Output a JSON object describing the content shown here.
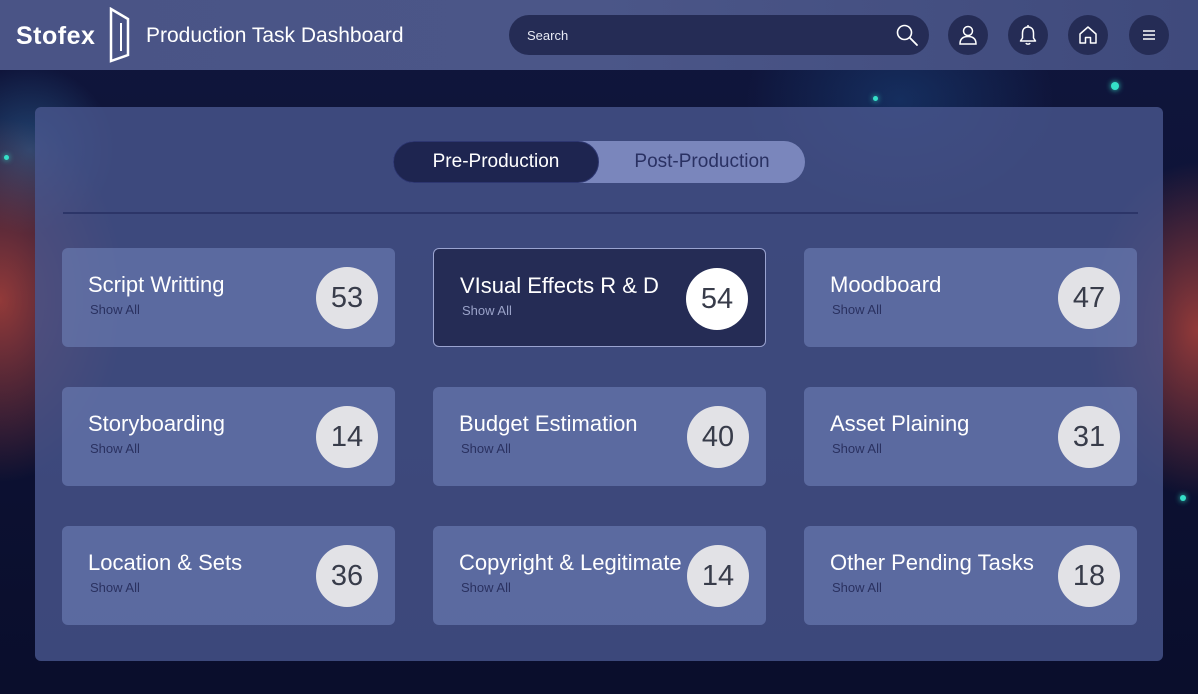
{
  "header": {
    "brand": "Stofex",
    "title": "Production Task Dashboard",
    "search_placeholder": "Search",
    "icons": [
      "user-icon",
      "bell-icon",
      "home-icon",
      "menu-icon"
    ]
  },
  "tabs": [
    {
      "label": "Pre-Production",
      "active": true
    },
    {
      "label": "Post-Production",
      "active": false
    }
  ],
  "cards": [
    {
      "title": "Script Writting",
      "link": "Show All",
      "count": "53"
    },
    {
      "title": "VIsual Effects R & D",
      "link": "Show All",
      "count": "54",
      "selected": true
    },
    {
      "title": "Moodboard",
      "link": "Show All",
      "count": "47"
    },
    {
      "title": "Storyboarding",
      "link": "Show All",
      "count": "14"
    },
    {
      "title": "Budget Estimation",
      "link": "Show All",
      "count": "40"
    },
    {
      "title": "Asset Plaining",
      "link": "Show All",
      "count": "31"
    },
    {
      "title": "Location & Sets",
      "link": "Show All",
      "count": "36"
    },
    {
      "title": "Copyright & Legitimate",
      "link": "Show All",
      "count": "14"
    },
    {
      "title": "Other Pending Tasks",
      "link": "Show All",
      "count": "18"
    }
  ],
  "colors": {
    "header_bg": "#4a5486",
    "panel_bg": "#48568c",
    "dark_navy": "#252c55",
    "accent_dot": "#35e0c8"
  }
}
